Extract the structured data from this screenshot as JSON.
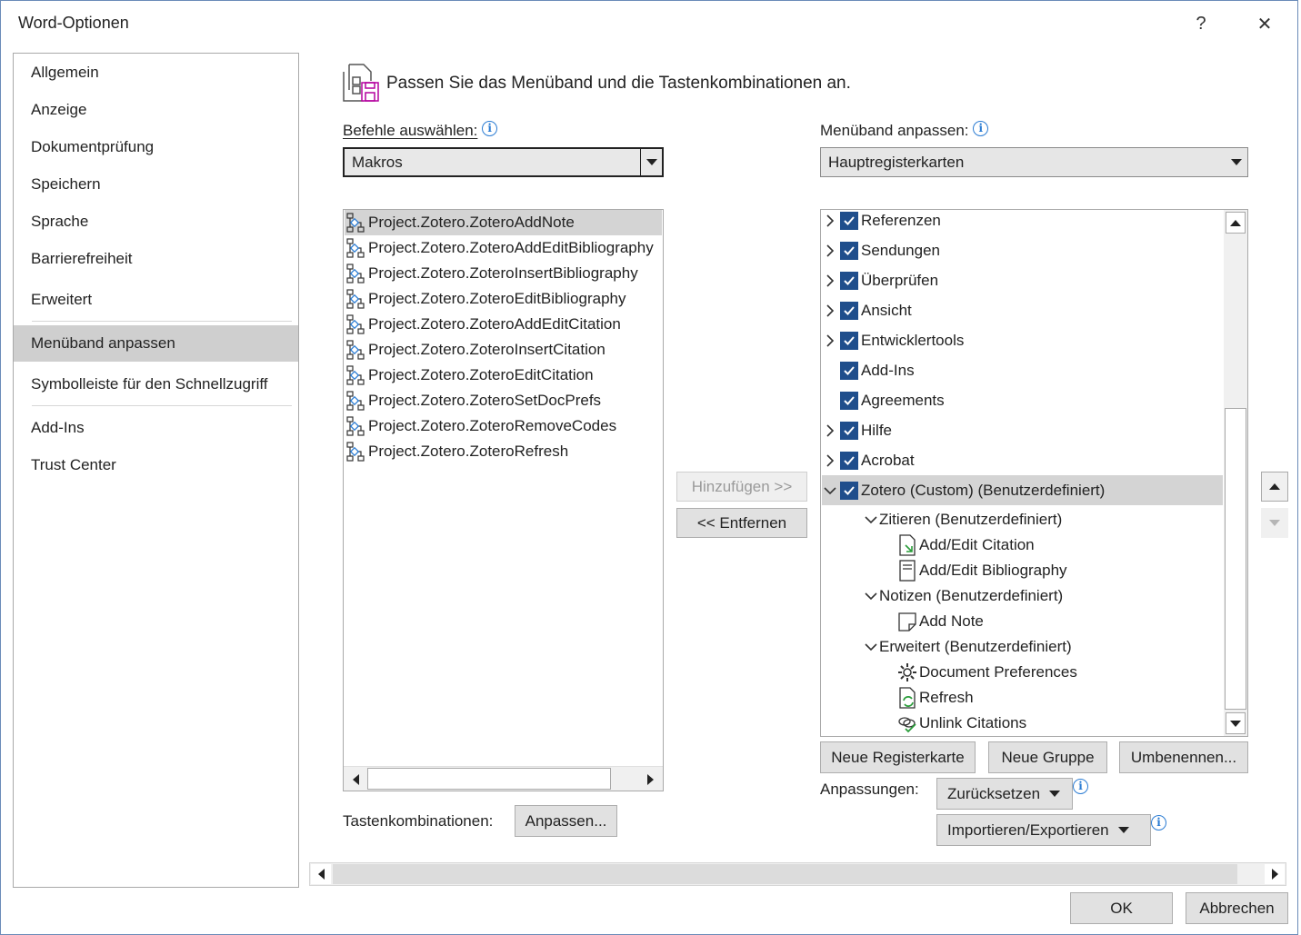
{
  "window": {
    "title": "Word-Optionen",
    "help_label": "?",
    "close_label": "✕"
  },
  "nav": {
    "items": [
      {
        "label": "Allgemein"
      },
      {
        "label": "Anzeige"
      },
      {
        "label": "Dokumentprüfung"
      },
      {
        "label": "Speichern"
      },
      {
        "label": "Sprache"
      },
      {
        "label": "Barrierefreiheit"
      },
      {
        "label": "Erweitert"
      },
      {
        "label": "Menüband anpassen",
        "selected": true
      },
      {
        "label": "Symbolleiste für den Schnellzugriff"
      },
      {
        "label": "Add-Ins"
      },
      {
        "label": "Trust Center"
      }
    ]
  },
  "main": {
    "heading": "Passen Sie das Menüband und die Tastenkombinationen an.",
    "commands_label": "Befehle auswählen:",
    "commands_value": "Makros",
    "ribbon_label": "Menüband anpassen:",
    "ribbon_value": "Hauptregisterkarten",
    "macros": [
      "Project.Zotero.ZoteroAddNote",
      "Project.Zotero.ZoteroAddEditBibliography",
      "Project.Zotero.ZoteroInsertBibliography",
      "Project.Zotero.ZoteroEditBibliography",
      "Project.Zotero.ZoteroAddEditCitation",
      "Project.Zotero.ZoteroInsertCitation",
      "Project.Zotero.ZoteroEditCitation",
      "Project.Zotero.ZoteroSetDocPrefs",
      "Project.Zotero.ZoteroRemoveCodes",
      "Project.Zotero.ZoteroRefresh"
    ],
    "add_button": "Hinzufügen >>",
    "remove_button": "<< Entfernen",
    "tabs": [
      {
        "label": "Referenzen",
        "expandable": true
      },
      {
        "label": "Sendungen",
        "expandable": true
      },
      {
        "label": "Überprüfen",
        "expandable": true
      },
      {
        "label": "Ansicht",
        "expandable": true
      },
      {
        "label": "Entwicklertools",
        "expandable": true
      },
      {
        "label": "Add-Ins",
        "expandable": false
      },
      {
        "label": "Agreements",
        "expandable": false
      },
      {
        "label": "Hilfe",
        "expandable": true
      },
      {
        "label": "Acrobat",
        "expandable": true
      },
      {
        "label": "Zotero (Custom) (Benutzerdefiniert)",
        "expandable": true,
        "expanded": true
      }
    ],
    "zotero_groups": {
      "cite_group": "Zitieren (Benutzerdefiniert)",
      "add_edit_citation": "Add/Edit Citation",
      "add_edit_bibliography": "Add/Edit Bibliography",
      "notes_group": "Notizen (Benutzerdefiniert)",
      "add_note": "Add Note",
      "advanced_group": "Erweitert (Benutzerdefiniert)",
      "doc_prefs": "Document Preferences",
      "refresh": "Refresh",
      "unlink": "Unlink Citations"
    },
    "new_tab_button": "Neue Registerkarte",
    "new_group_button": "Neue Gruppe",
    "rename_button": "Umbenennen...",
    "customizations_label": "Anpassungen:",
    "reset_button": "Zurücksetzen",
    "import_export_button": "Importieren/Exportieren",
    "shortcuts_label": "Tastenkombinationen:",
    "customize_button": "Anpassen..."
  },
  "footer": {
    "ok_button": "OK",
    "cancel_button": "Abbrechen"
  },
  "colors": {
    "checkbox": "#1f4e8c",
    "selection": "#cfcfcf",
    "info": "#2b7cd3",
    "accent_icon": "#b4009e"
  }
}
